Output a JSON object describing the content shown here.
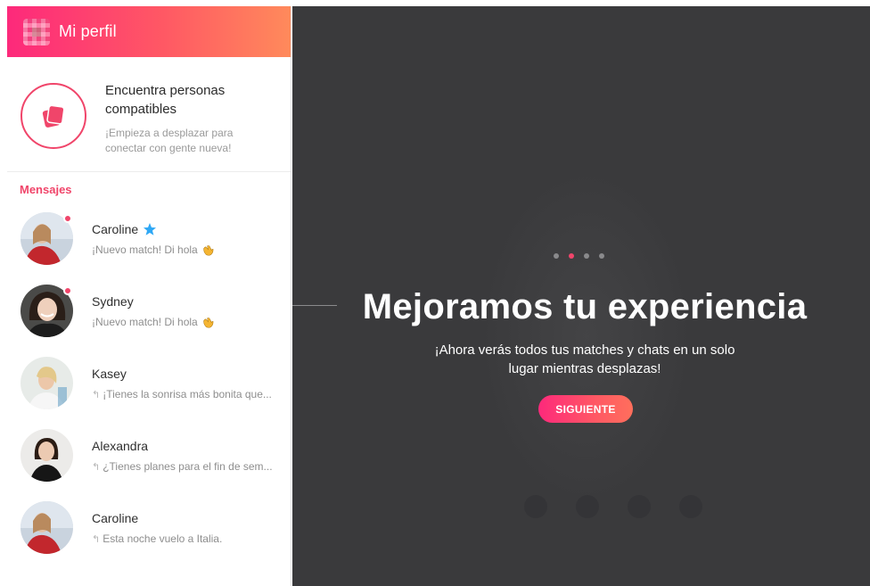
{
  "header": {
    "title": "Mi perfil"
  },
  "discover": {
    "title": "Encuentra personas compatibles",
    "subtitle": "¡Empieza a desplazar para conectar con gente nueva!"
  },
  "messages": {
    "section_label": "Mensajes",
    "items": [
      {
        "name": "Caroline",
        "preview": "¡Nuevo match! Di hola",
        "online": true,
        "verified": true,
        "emoji": "wave"
      },
      {
        "name": "Sydney",
        "preview": "¡Nuevo match! Di hola",
        "online": true,
        "verified": false,
        "emoji": "wave"
      },
      {
        "name": "Kasey",
        "preview": "¡Tienes la sonrisa más bonita que...",
        "online": false,
        "verified": false,
        "reply": true
      },
      {
        "name": "Alexandra",
        "preview": "¿Tienes planes para el fin de sem...",
        "online": false,
        "verified": false,
        "reply": true
      },
      {
        "name": "Caroline",
        "preview": "Esta noche vuelo a Italia.",
        "online": false,
        "verified": false,
        "reply": true
      }
    ]
  },
  "onboarding": {
    "title": "Mejoramos tu experiencia",
    "subtitle": "¡Ahora verás todos tus matches y chats en un solo lugar mientras desplazas!",
    "button_label": "SIGUIENTE",
    "pager": {
      "total": 4,
      "active_index": 1
    }
  },
  "colors": {
    "brand_pink": "#f0456a",
    "gradient_start": "#fd297b",
    "gradient_end": "#ff8a5b",
    "main_bg": "#3a3a3c"
  },
  "icons": {
    "discover": "cards-stack-icon",
    "verified": "star-badge-icon",
    "wave": "waving-hand-icon",
    "reply": "reply-arrow-icon"
  }
}
